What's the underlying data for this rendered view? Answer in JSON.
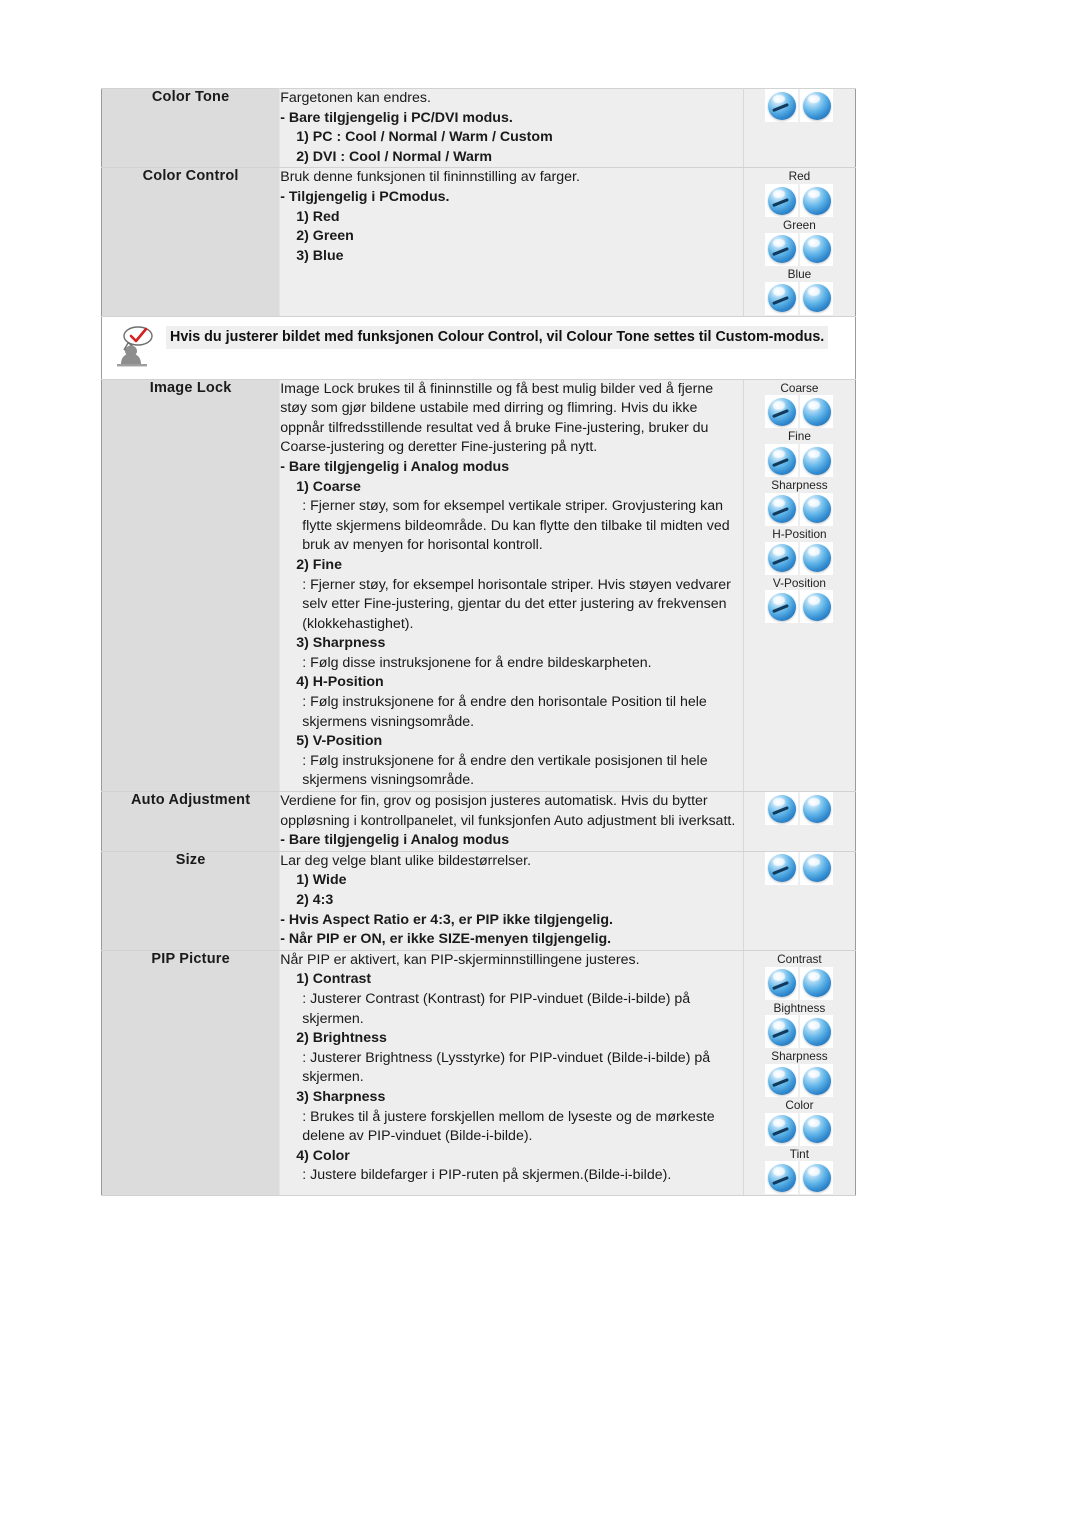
{
  "document": {
    "language": "Norwegian",
    "kind": "monitor-osd-manual-table"
  },
  "table": {
    "rows": [
      {
        "id": "color-tone",
        "label": "Color Tone",
        "desc_lines": [
          {
            "style": "plain",
            "text": "Fargetonen kan endres."
          },
          {
            "style": "bold",
            "text": "- Bare tilgjengelig i PC/DVI modus."
          },
          {
            "style": "lvl1",
            "text": "1) PC : Cool / Normal / Warm / Custom"
          },
          {
            "style": "lvl1",
            "text": "2) DVI : Cool / Normal / Warm"
          }
        ],
        "buttons": [
          {
            "label": "",
            "icons": [
              "arrow-orb-icon",
              "plain-orb-icon"
            ]
          }
        ]
      },
      {
        "id": "color-control",
        "label": "Color Control",
        "desc_lines": [
          {
            "style": "plain",
            "text": "Bruk denne funksjonen til fininnstilling av farger."
          },
          {
            "style": "bold",
            "text": "- Tilgjengelig i PCmodus."
          },
          {
            "style": "lvl1",
            "text": "1) Red"
          },
          {
            "style": "lvl1",
            "text": "2) Green"
          },
          {
            "style": "lvl1",
            "text": "3) Blue"
          }
        ],
        "buttons": [
          {
            "label": "Red",
            "icons": [
              "arrow-orb-icon",
              "plain-orb-icon"
            ]
          },
          {
            "label": "Green",
            "icons": [
              "arrow-orb-icon",
              "plain-orb-icon"
            ]
          },
          {
            "label": "Blue",
            "icons": [
              "arrow-orb-icon",
              "plain-orb-icon"
            ]
          }
        ]
      },
      {
        "id": "image-lock",
        "label": "Image Lock",
        "desc_lines": [
          {
            "style": "plain",
            "text": "Image Lock brukes til å fininnstille og få best mulig bilder ved å fjerne støy som gjør bildene ustabile med dirring og flimring. Hvis du ikke oppnår tilfredsstillende resultat ved å bruke Fine-justering, bruker du Coarse-justering og deretter Fine-justering på nytt."
          },
          {
            "style": "bold",
            "text": "- Bare tilgjengelig i Analog modus"
          },
          {
            "style": "lvl1",
            "text": "1) Coarse"
          },
          {
            "style": "lvl2",
            "text": ": Fjerner støy, som for eksempel vertikale striper. Grovjustering kan flytte skjermens bildeområde. Du kan flytte den tilbake til midten ved bruk av menyen for horisontal kontroll."
          },
          {
            "style": "lvl1",
            "text": "2) Fine"
          },
          {
            "style": "lvl2",
            "text": ": Fjerner støy, for eksempel horisontale striper. Hvis støyen vedvarer selv etter Fine-justering, gjentar du det etter justering av frekvensen (klokkehastighet)."
          },
          {
            "style": "lvl1",
            "text": "3) Sharpness"
          },
          {
            "style": "lvl2",
            "text": ": Følg disse instruksjonene for å endre bildeskarpheten."
          },
          {
            "style": "lvl1",
            "text": "4) H-Position"
          },
          {
            "style": "lvl2",
            "text": ": Følg instruksjonene for å endre den horisontale Position til hele skjermens visningsområde."
          },
          {
            "style": "lvl1",
            "text": "5) V-Position"
          },
          {
            "style": "lvl2",
            "text": ": Følg instruksjonene for å endre den vertikale posisjonen til hele skjermens visningsområde."
          }
        ],
        "buttons": [
          {
            "label": "Coarse",
            "icons": [
              "arrow-orb-icon",
              "plain-orb-icon"
            ]
          },
          {
            "label": "Fine",
            "icons": [
              "arrow-orb-icon",
              "plain-orb-icon"
            ]
          },
          {
            "label": "Sharpness",
            "icons": [
              "arrow-orb-icon",
              "plain-orb-icon"
            ]
          },
          {
            "label": "H-Position",
            "icons": [
              "arrow-orb-icon",
              "plain-orb-icon"
            ]
          },
          {
            "label": "V-Position",
            "icons": [
              "arrow-orb-icon",
              "plain-orb-icon"
            ]
          }
        ]
      },
      {
        "id": "auto-adjustment",
        "label": "Auto Adjustment",
        "desc_lines": [
          {
            "style": "plain",
            "text": "Verdiene for fin, grov og posisjon justeres automatisk. Hvis du bytter oppløsning i kontrollpanelet, vil funksjonfen Auto adjustment bli iverksatt."
          },
          {
            "style": "bold",
            "text": "- Bare tilgjengelig i Analog modus"
          }
        ],
        "buttons": [
          {
            "label": "",
            "icons": [
              "arrow-orb-icon",
              "plain-orb-icon"
            ]
          }
        ]
      },
      {
        "id": "size",
        "label": "Size",
        "desc_lines": [
          {
            "style": "plain",
            "text": "Lar deg velge blant ulike bildestørrelser."
          },
          {
            "style": "lvl1",
            "text": "1) Wide"
          },
          {
            "style": "lvl1",
            "text": "2) 4:3"
          },
          {
            "style": "bold",
            "text": "- Hvis Aspect Ratio er 4:3, er PIP ikke tilgjengelig."
          },
          {
            "style": "bold",
            "text": "- Når PIP er ON, er ikke SIZE-menyen tilgjengelig."
          }
        ],
        "buttons": [
          {
            "label": "",
            "icons": [
              "arrow-orb-icon",
              "plain-orb-icon"
            ]
          }
        ]
      },
      {
        "id": "pip-picture",
        "label": "PIP Picture",
        "desc_lines": [
          {
            "style": "plain",
            "text": "Når PIP er aktivert, kan PIP-skjerminnstillingene justeres."
          },
          {
            "style": "lvl1",
            "text": "1) Contrast"
          },
          {
            "style": "lvl2",
            "text": ": Justerer Contrast (Kontrast) for PIP-vinduet (Bilde-i-bilde) på skjermen."
          },
          {
            "style": "lvl1",
            "text": "2) Brightness"
          },
          {
            "style": "lvl2",
            "text": ": Justerer Brightness (Lysstyrke) for PIP-vinduet (Bilde-i-bilde) på skjermen."
          },
          {
            "style": "lvl1",
            "text": "3) Sharpness"
          },
          {
            "style": "lvl2",
            "text": ": Brukes til å justere forskjellen mellom de lyseste og de mørkeste delene av PIP-vinduet (Bilde-i-bilde)."
          },
          {
            "style": "lvl1",
            "text": "4) Color"
          },
          {
            "style": "lvl2",
            "text": ": Justere bildefarger i PIP-ruten på skjermen.(Bilde-i-bilde)."
          }
        ],
        "buttons": [
          {
            "label": "Contrast",
            "icons": [
              "arrow-orb-icon",
              "plain-orb-icon"
            ]
          },
          {
            "label": "Bightness",
            "icons": [
              "arrow-orb-icon",
              "plain-orb-icon"
            ]
          },
          {
            "label": "Sharpness",
            "icons": [
              "arrow-orb-icon",
              "plain-orb-icon"
            ]
          },
          {
            "label": "Color",
            "icons": [
              "arrow-orb-icon",
              "plain-orb-icon"
            ]
          },
          {
            "label": "Tint",
            "icons": [
              "arrow-orb-icon",
              "plain-orb-icon"
            ]
          }
        ]
      }
    ],
    "note": {
      "icon": "person-speech-bubble-check-icon",
      "text": "Hvis du justerer bildet med funksjonen Colour Control, vil Colour Tone settes til Custom-modus.",
      "after_row": "color-control"
    }
  },
  "colors": {
    "label_cell_bg": "#dcdcdc",
    "desc_cell_bg": "#eeeeee",
    "border": "#d2d2d2",
    "outer_border": "#9a9a9a",
    "orb_blue": "#3f96d8",
    "note_check_red": "#d42020",
    "text": "#1a1a1a"
  }
}
